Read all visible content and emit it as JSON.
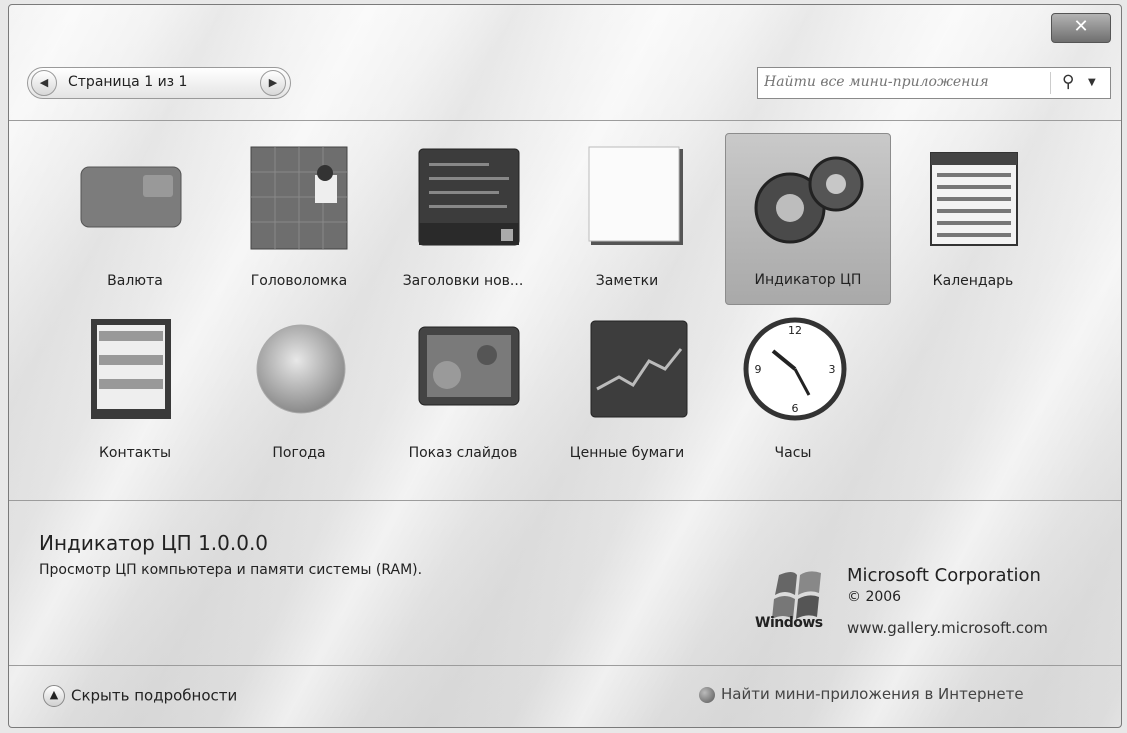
{
  "window": {
    "close_label": "✕"
  },
  "pager": {
    "label": "Страница 1 из 1",
    "prev_icon": "chevron-left-icon",
    "next_icon": "chevron-right-icon"
  },
  "search": {
    "placeholder": "Найти все мини-приложения"
  },
  "gadgets": [
    {
      "label": "Валюта",
      "icon": "currency-icon"
    },
    {
      "label": "Головоломка",
      "icon": "puzzle-icon"
    },
    {
      "label": "Заголовки нов...",
      "icon": "news-feed-icon"
    },
    {
      "label": "Заметки",
      "icon": "notes-icon"
    },
    {
      "label": "Индикатор ЦП",
      "icon": "cpu-meter-icon",
      "selected": true
    },
    {
      "label": "Календарь",
      "icon": "calendar-icon"
    },
    {
      "label": "Контакты",
      "icon": "contacts-icon"
    },
    {
      "label": "Погода",
      "icon": "weather-icon"
    },
    {
      "label": "Показ слайдов",
      "icon": "slideshow-icon"
    },
    {
      "label": "Ценные бумаги",
      "icon": "stocks-icon"
    },
    {
      "label": "Часы",
      "icon": "clock-icon"
    }
  ],
  "details": {
    "title": "Индикатор ЦП 1.0.0.0",
    "description": "Просмотр ЦП компьютера и памяти системы (RAM).",
    "publisher": "Microsoft Corporation",
    "copyright": "© 2006",
    "website": "www.gallery.microsoft.com",
    "logo_text": "Windows"
  },
  "footer": {
    "hide_details": "Скрыть подробности",
    "get_online": "Найти мини-приложения в Интернете"
  }
}
